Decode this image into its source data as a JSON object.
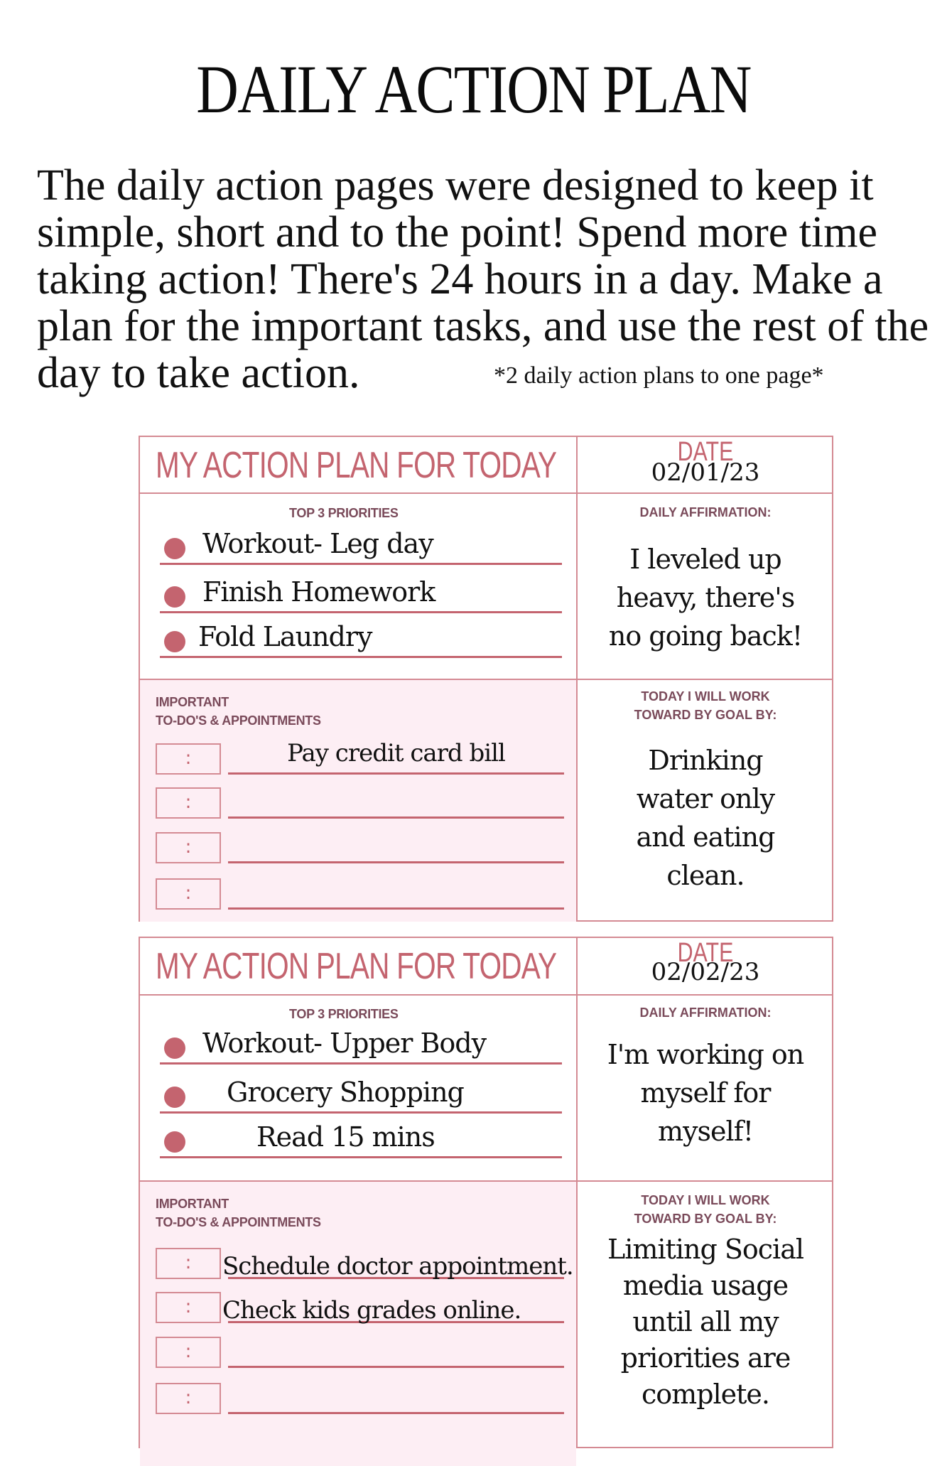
{
  "title": "DAILY ACTION PLAN",
  "intro": {
    "lines": [
      "The daily action pages were designed to keep it",
      "simple, short and to the point! Spend more time",
      "taking action! There's 24 hours in a day. Make a",
      "plan for the important tasks, and use the rest of the",
      "day to take action."
    ],
    "note": "*2 daily action plans to one page*"
  },
  "colors": {
    "accent": "#c4646f",
    "border": "#d48a93",
    "label": "#7a4a5a",
    "pink_fill": "#fdeef4"
  },
  "labels": {
    "plan_title": "MY ACTION PLAN FOR TODAY",
    "date": "DATE",
    "top_priorities": "TOP 3 PRIORITIES",
    "daily_affirmation": "DAILY AFFIRMATION:",
    "important_1": "IMPORTANT",
    "important_2": "TO-DO'S & APPOINTMENTS",
    "goal_1": "TODAY I WILL WORK",
    "goal_2": "TOWARD BY GOAL BY:",
    "time_separator": ":"
  },
  "plans": [
    {
      "date": "02/01/23",
      "priorities": [
        "Workout- Leg day",
        "Finish Homework",
        "Fold Laundry"
      ],
      "affirmation": [
        "I leveled up",
        "heavy, there's",
        "no going back!"
      ],
      "todos": [
        "Pay credit card bill",
        "",
        "",
        ""
      ],
      "goal": [
        "Drinking",
        "water only",
        "and eating",
        "clean."
      ]
    },
    {
      "date": "02/02/23",
      "priorities": [
        "Workout- Upper Body",
        "Grocery Shopping",
        "Read 15 mins"
      ],
      "affirmation": [
        "I'm working on",
        "myself for",
        "myself!"
      ],
      "todos": [
        "Schedule doctor appointment.",
        "Check kids grades online.",
        "",
        ""
      ],
      "goal": [
        "Limiting Social",
        "media usage",
        "until all my",
        "priorities are",
        "complete."
      ]
    }
  ]
}
